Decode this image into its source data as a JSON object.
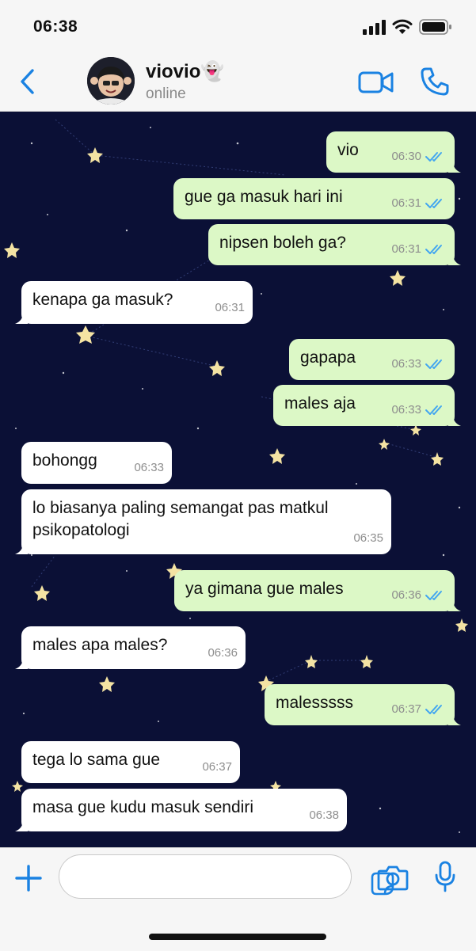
{
  "status_bar": {
    "time": "06:38"
  },
  "header": {
    "contact_name": "viovio👻",
    "contact_status": "online"
  },
  "colors": {
    "accent": "#1a82e2",
    "outgoing_bubble": "#dcf8c6",
    "incoming_bubble": "#ffffff",
    "chat_background": "#0b1036",
    "read_ticks": "#43a6f0"
  },
  "messages": [
    {
      "direction": "out",
      "text": "vio",
      "time": "06:30",
      "read": true
    },
    {
      "direction": "out",
      "text": "gue ga masuk hari ini",
      "time": "06:31",
      "read": true
    },
    {
      "direction": "out",
      "text": "nipsen boleh ga?",
      "time": "06:31",
      "read": true
    },
    {
      "direction": "in",
      "text": "kenapa ga masuk?",
      "time": "06:31"
    },
    {
      "direction": "out",
      "text": "gapapa",
      "time": "06:33",
      "read": true
    },
    {
      "direction": "out",
      "text": "males aja",
      "time": "06:33",
      "read": true
    },
    {
      "direction": "in",
      "text": "bohongg",
      "time": "06:33"
    },
    {
      "direction": "in",
      "text": "lo biasanya paling semangat pas matkul\npsikopatologi",
      "time": "06:35"
    },
    {
      "direction": "out",
      "text": "ya gimana gue males",
      "time": "06:36",
      "read": true
    },
    {
      "direction": "in",
      "text": "males apa males?",
      "time": "06:36"
    },
    {
      "direction": "out",
      "text": "malesssss",
      "time": "06:37",
      "read": true
    },
    {
      "direction": "in",
      "text": "tega lo sama gue",
      "time": "06:37"
    },
    {
      "direction": "in",
      "text": "masa gue kudu masuk sendiri",
      "time": "06:38"
    }
  ],
  "icons": {
    "back": "chevron-left-icon",
    "video": "video-camera-icon",
    "call": "phone-icon",
    "plus": "plus-icon",
    "sticker": "sticker-icon",
    "camera": "camera-icon",
    "mic": "microphone-icon",
    "read_receipt": "double-check-icon"
  }
}
